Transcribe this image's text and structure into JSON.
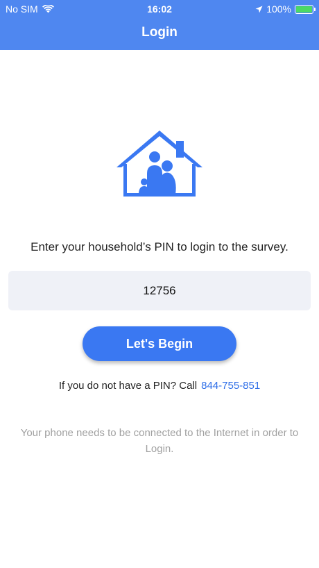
{
  "status_bar": {
    "carrier": "No SIM",
    "time": "16:02",
    "battery_percent": "100%",
    "battery_level": 1.0
  },
  "nav": {
    "title": "Login"
  },
  "main": {
    "instruction": "Enter your household’s PIN to login to the survey.",
    "pin_value": "12756",
    "begin_label": "Let's Begin",
    "pin_help_text": "If you do not have a PIN? Call",
    "phone_number": "844-755-851",
    "internet_note": "Your phone needs to be connected to the Internet in order to Login."
  },
  "icons": {
    "logo": "house-family-icon",
    "wifi": "wifi-icon",
    "location": "location-arrow-icon",
    "battery": "battery-charging-icon"
  },
  "colors": {
    "accent": "#4f87f0",
    "button": "#3a78f2",
    "link": "#2f6fe8",
    "battery": "#4cd964"
  }
}
